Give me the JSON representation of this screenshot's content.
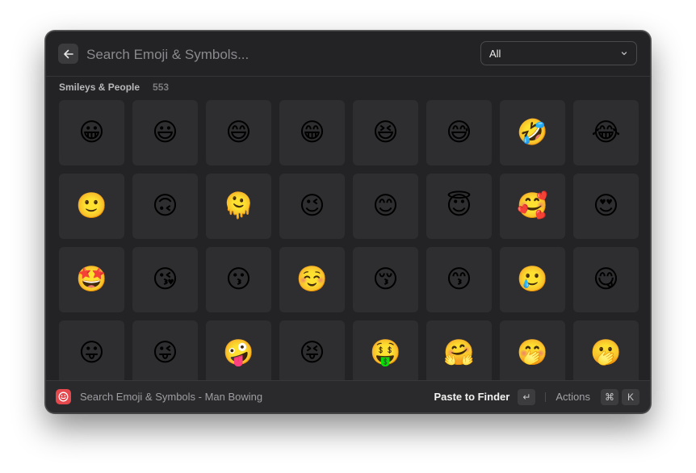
{
  "search": {
    "placeholder": "Search Emoji & Symbols..."
  },
  "filter": {
    "selected": "All"
  },
  "section": {
    "title": "Smileys & People",
    "count": "553"
  },
  "emojis": [
    "😀",
    "😃",
    "😄",
    "😁",
    "😆",
    "😅",
    "🤣",
    "😂",
    "🙂",
    "🙃",
    "🫠",
    "😉",
    "😊",
    "😇",
    "🥰",
    "😍",
    "🤩",
    "😘",
    "😗",
    "☺️",
    "😚",
    "😙",
    "🥲",
    "😋",
    "😛",
    "😜",
    "🤪",
    "😝",
    "🤑",
    "🤗",
    "🤭",
    "🫢"
  ],
  "footer": {
    "title": "Search Emoji & Symbols - Man Bowing",
    "primary_action": "Paste to Finder",
    "enter_key": "↵",
    "actions_label": "Actions",
    "cmd_key": "⌘",
    "k_key": "K"
  },
  "colors": {
    "accent": "#e5484d",
    "window_bg": "#232325",
    "cell_bg": "#2e2e30"
  },
  "icons": {
    "back": "arrow-left-icon",
    "dropdown": "chevron-down-icon",
    "app": "smiley-app-icon"
  }
}
